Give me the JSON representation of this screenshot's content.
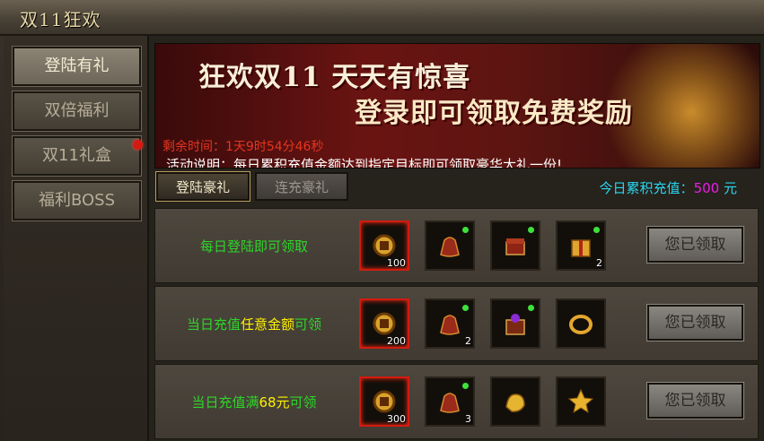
{
  "window": {
    "title": "双11狂欢"
  },
  "sidebar": {
    "items": [
      {
        "label": "登陆有礼",
        "active": true
      },
      {
        "label": "双倍福利",
        "active": false
      },
      {
        "label": "双11礼盒",
        "active": false,
        "badge": true
      },
      {
        "label": "福利BOSS",
        "active": false
      }
    ]
  },
  "banner": {
    "line1": "狂欢双11  天天有惊喜",
    "line2": "登录即可领取免费奖励",
    "timer_label": "剩余时间：",
    "timer_value": "1天9时54分46秒",
    "desc_label": "活动说明：",
    "desc_text": "每日累积充值金额达到指定目标即可领取豪华大礼一份!"
  },
  "tabs": [
    {
      "label": "登陆豪礼",
      "active": true
    },
    {
      "label": "连充豪礼",
      "active": false
    }
  ],
  "today": {
    "label": "今日累积充值：",
    "amount": "500",
    "unit": "元"
  },
  "rows": [
    {
      "condition": {
        "pre": "每日登陆即可领取",
        "hl": "",
        "post": ""
      },
      "items": [
        {
          "icon": "coin-pouch-icon",
          "count": "100",
          "frame": "red"
        },
        {
          "icon": "red-bag-icon",
          "count": "",
          "dot": true
        },
        {
          "icon": "treasure-chest-icon",
          "count": "",
          "dot": true
        },
        {
          "icon": "gold-giftbox-icon",
          "count": "2",
          "dot": true
        }
      ],
      "button": "您已领取"
    },
    {
      "condition": {
        "pre": "当日充值",
        "hl": "任意金额",
        "post": "可领"
      },
      "items": [
        {
          "icon": "coin-pouch-icon",
          "count": "200",
          "frame": "red"
        },
        {
          "icon": "red-bag-icon",
          "count": "2",
          "dot": true
        },
        {
          "icon": "jeweled-chest-icon",
          "count": "",
          "dot": true
        },
        {
          "icon": "gold-ring-icon",
          "count": ""
        }
      ],
      "button": "您已领取"
    },
    {
      "condition": {
        "pre": "当日充值满",
        "hl": "68元",
        "post": "可领"
      },
      "items": [
        {
          "icon": "coin-pouch-icon",
          "count": "300",
          "frame": "red"
        },
        {
          "icon": "red-bag-icon",
          "count": "3",
          "dot": true
        },
        {
          "icon": "gold-ore-icon",
          "count": ""
        },
        {
          "icon": "gold-star-icon",
          "count": ""
        }
      ],
      "button": "您已领取"
    }
  ],
  "colors": {
    "accent_green": "#2ed52a",
    "highlight_yellow": "#fff000",
    "timer_red": "#e8351f",
    "amount_magenta": "#e81fe6",
    "today_cyan": "#27d6ee"
  }
}
